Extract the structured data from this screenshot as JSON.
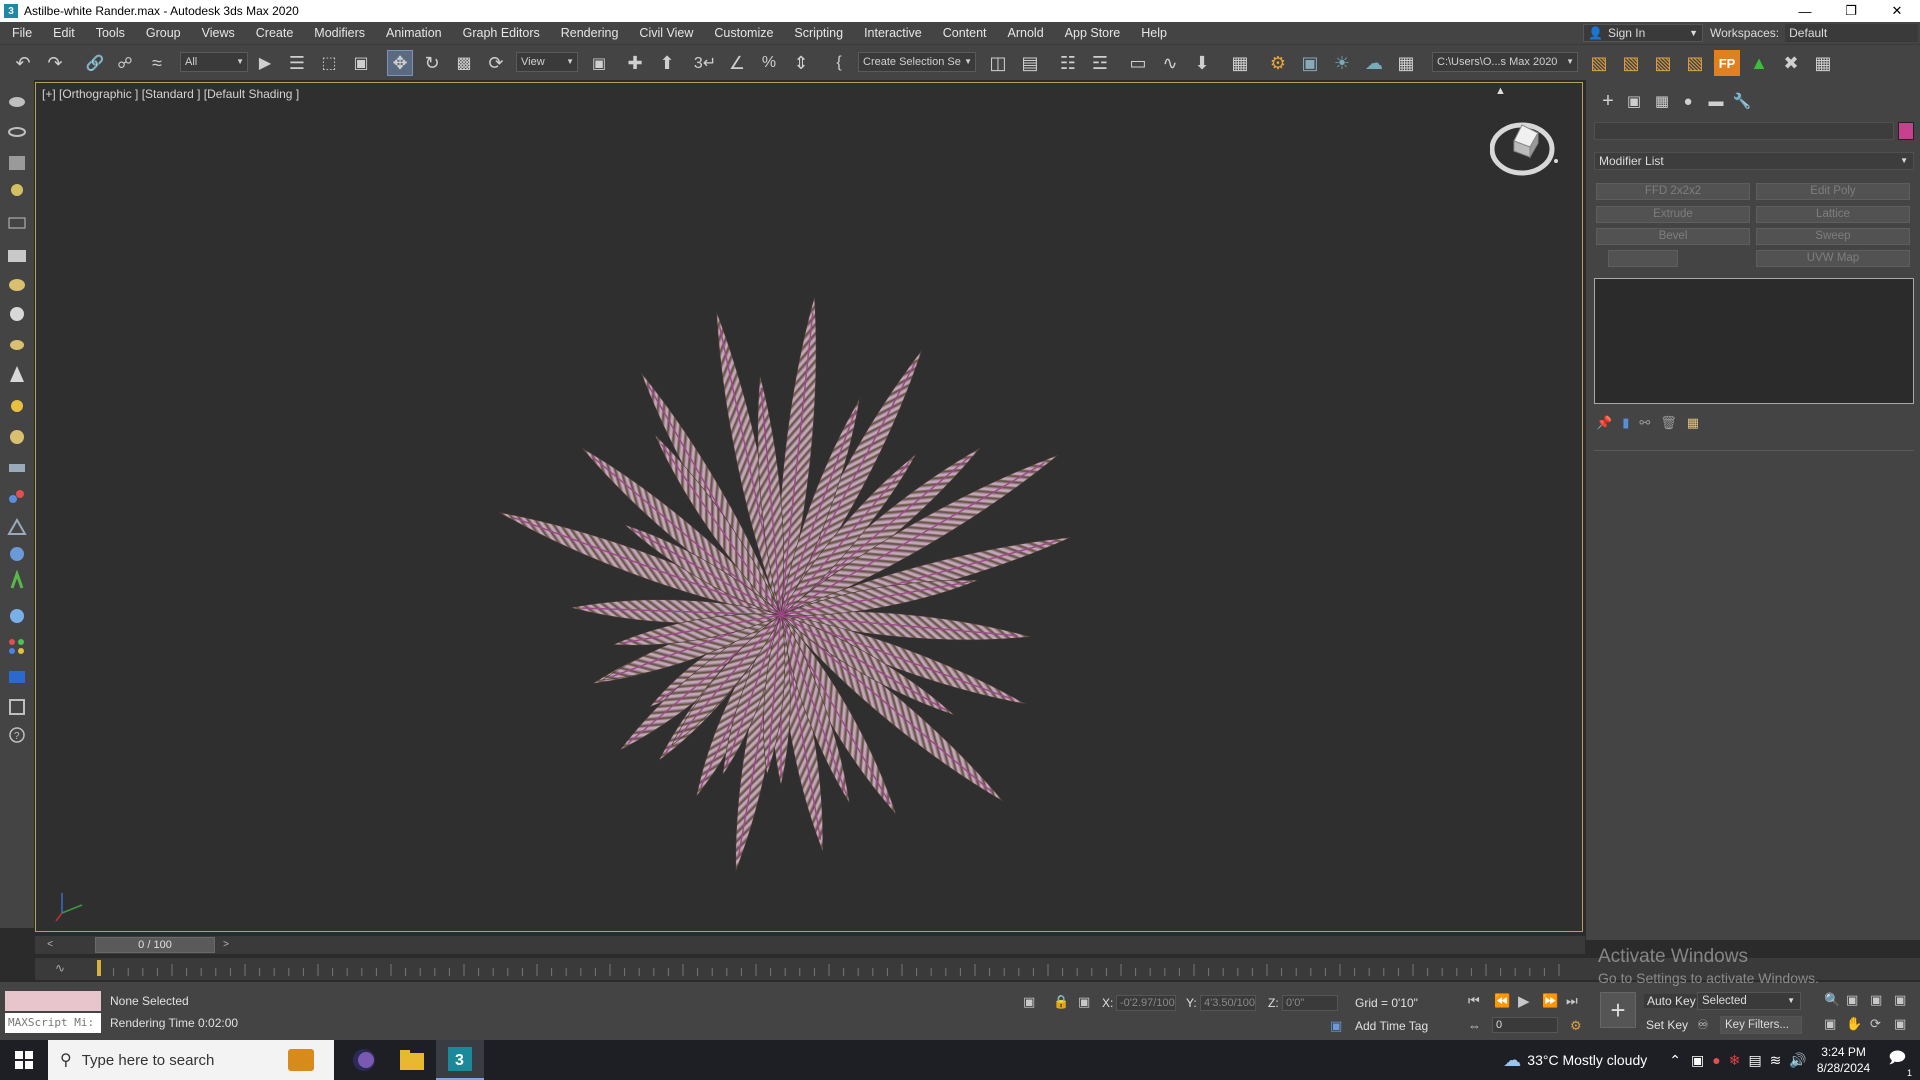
{
  "window": {
    "title": "Astilbe-white Rander.max - Autodesk 3ds Max 2020",
    "app_icon": "3",
    "controls": [
      "minimize-icon",
      "restore-icon",
      "close-icon"
    ]
  },
  "menubar": {
    "items": [
      "File",
      "Edit",
      "Tools",
      "Group",
      "Views",
      "Create",
      "Modifiers",
      "Animation",
      "Graph Editors",
      "Rendering",
      "Civil View",
      "Customize",
      "Scripting",
      "Interactive",
      "Content",
      "Arnold",
      "App Store",
      "Help"
    ],
    "sign_in": "Sign In",
    "workspaces_label": "Workspaces:",
    "workspace_value": "Default"
  },
  "toolbar": {
    "selection_filter": "All",
    "reference_coord": "View",
    "named_selection": "Create Selection Se",
    "project_path": "C:\\Users\\O...s Max 2020"
  },
  "viewport": {
    "label": "[+] [Orthographic ] [Standard ] [Default Shading ]"
  },
  "command_panel": {
    "modifier_list": "Modifier List",
    "modifier_buttons": [
      "FFD 2x2x2",
      "Edit Poly",
      "Extrude",
      "Lattice",
      "Bevel",
      "Sweep",
      "",
      "UVW Map"
    ],
    "object_color": "#c8418d"
  },
  "timeline": {
    "position": "0 / 100"
  },
  "status": {
    "maxscript_placeholder": "MAXScript Mi:",
    "selection": "None Selected",
    "rendering_time": "Rendering Time  0:02:00",
    "x_label": "X:",
    "x_value": "-0'2.97/100\"",
    "y_label": "Y:",
    "y_value": "4'3.50/100\"",
    "z_label": "Z:",
    "z_value": "0'0\"",
    "grid": "Grid = 0'10\"",
    "add_time_tag": "Add Time Tag",
    "auto_key": "Auto Key",
    "set_key": "Set Key",
    "key_mode": "Selected",
    "key_filters": "Key Filters...",
    "frame": "0"
  },
  "watermark": {
    "title": "Activate Windows",
    "subtitle": "Go to Settings to activate Windows."
  },
  "taskbar": {
    "search_placeholder": "Type here to search",
    "weather": "33°C  Mostly cloudy",
    "time": "3:24 PM",
    "date": "8/28/2024",
    "notification_count": "1"
  }
}
